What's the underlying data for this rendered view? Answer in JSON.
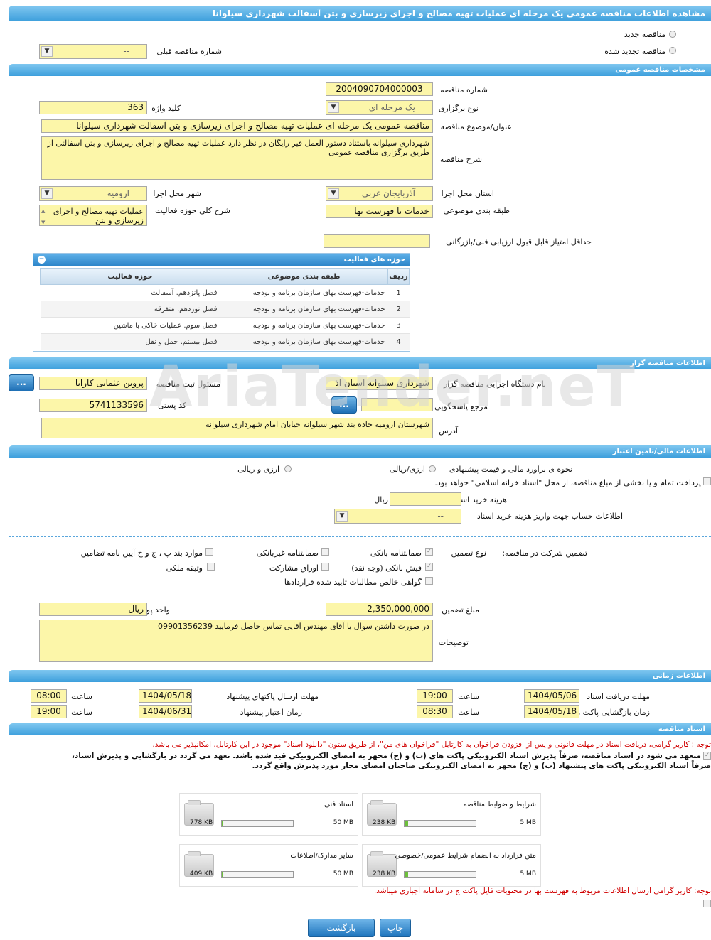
{
  "page_title": "مشاهده اطلاعات مناقصه عمومی یک مرحله ای عملیات تهیه مصالح و اجرای زیرسازی و بتن آسفالت شهرداری سیلوانا",
  "top": {
    "radio_new": "مناقصه جدید",
    "radio_renew": "مناقصه تجدید شده",
    "prev_label": "شماره مناقصه قبلی",
    "prev_value": "--"
  },
  "general": {
    "header": "مشخصات مناقصه عمومی",
    "tender_no_label": "شماره مناقصه",
    "tender_no": "2004090704000003",
    "type_label": "نوع برگزاری",
    "type_value": "یک مرحله ای",
    "keyword_label": "کلید واژه",
    "keyword": "363",
    "title_label": "عنوان/موضوع مناقصه",
    "title_value": "مناقصه عمومی یک مرحله ای عملیات تهیه مصالح و اجرای زیرسازی و بتن آسفالت شهرداری سیلوانا",
    "desc_label": "شرح مناقصه",
    "desc_value": "شهرداری سیلوانه باستناد دستور العمل فیر رایگان در نظر دارد عملیات تهیه مصالح و اجرای زیرسازی و بتن آسفالتی از طریق برگزاری مناقصه عمومی",
    "province_label": "استان محل اجرا",
    "province": "آذربایجان غربی",
    "city_label": "شهر محل اجرا",
    "city": "ارومیه",
    "category_label": "طبقه بندی موضوعی",
    "category": "خدمات با فهرست بها",
    "scope_label": "شرح کلی حوزه فعالیت",
    "scope": "عملیات تهیه مصالح و اجرای زیرسازی و بتن",
    "min_score_label": "حداقل امتیاز قابل قبول ارزیابی فنی/بازرگانی"
  },
  "activities": {
    "header": "حوزه های فعالیت",
    "cols": [
      "ردیف",
      "طبقه بندی موضوعی",
      "حوزه فعالیت"
    ],
    "rows": [
      [
        "1",
        "خدمات-فهرست بهای سازمان برنامه و بودجه",
        "فصل پانزدهم. آسفالت"
      ],
      [
        "2",
        "خدمات-فهرست بهای سازمان برنامه و بودجه",
        "فصل نوزدهم. متفرقه"
      ],
      [
        "3",
        "خدمات-فهرست بهای سازمان برنامه و بودجه",
        "فصل سوم. عملیات خاکی با ماشین"
      ],
      [
        "4",
        "خدمات-فهرست بهای سازمان برنامه و بودجه",
        "فصل بیستم. حمل و نقل"
      ]
    ]
  },
  "organizer": {
    "header": "اطلاعات مناقصه گزار",
    "org_label": "نام دستگاه اجرایی مناقصه گزار",
    "org": "شهرداری سیلوانه استان اذ",
    "resp_label": "مسئول ثبت مناقصه",
    "resp": "پروین  عثمانی کارانا",
    "ref_label": "مرجع پاسخگویی",
    "ref": "",
    "postal_label": "کد پستی",
    "postal": "5741133596",
    "addr_label": "آدرس",
    "addr": "شهرستان ارومیه جاده بند شهر سیلوانه خیابان امام شهرداری سیلوانه",
    "dots": "..."
  },
  "finance": {
    "header": "اطلاعات مالی/تامین اعتبار",
    "estimate_label": "نحوه ی برآورد مالی و قیمت پیشنهادی",
    "opt1": "ارزی/ریالی",
    "opt2": "ارزی و ریالی",
    "islamic_note": "پرداخت تمام و یا بخشی از مبلغ مناقصه، از محل \"اسناد خزانه اسلامی\" خواهد بود.",
    "doc_cost_label": "هزینه خرید اسناد",
    "doc_cost": "",
    "rial": "ریال",
    "account_label": "اطلاعات حساب جهت واریز هزینه خرید اسناد",
    "account": "--"
  },
  "guarantee": {
    "label": "تضمین شرکت در مناقصه:",
    "type_label": "نوع تضمین",
    "items": [
      "ضمانتنامه بانکی",
      "ضمانتنامه غیربانکی",
      "موارد بند پ ، ج و خ آیین نامه تضامین",
      "فیش بانکی (وجه نقد)",
      "اوراق مشارکت",
      "وثیقه ملکی",
      "گواهی خالص مطالبات تایید شده قراردادها"
    ],
    "amount_label": "مبلغ تضمین",
    "amount": "2,350,000,000",
    "unit_label": "واحد پول",
    "unit": "ریال",
    "notes_label": "توضیحات",
    "notes": "در صورت داشتن سوال با آقای مهندس آقایی تماس حاصل فرمایید  09901356239"
  },
  "timing": {
    "header": "اطلاعات زمانی",
    "receive_label": "مهلت دریافت اسناد",
    "receive_date": "1404/05/06",
    "receive_time": "19:00",
    "send_label": "مهلت ارسال پاکتهای پیشنهاد",
    "send_date": "1404/05/18",
    "send_time": "08:00",
    "open_label": "زمان بازگشایی پاکت ها",
    "open_date": "1404/05/18",
    "open_time": "08:30",
    "valid_label": "زمان اعتبار پیشنهاد",
    "valid_date": "1404/06/31",
    "valid_time": "19:00",
    "time_label": "ساعت"
  },
  "docs": {
    "header": "اسناد مناقصه",
    "note1": "توجه : کاربر گرامی، دریافت اسناد در مهلت قانونی و پس از افزودن فراخوان به کارتابل \"فراخوان های من\"، از طریق ستون \"دانلود اسناد\" موجود در این کارتابل، امکانپذیر می باشد.",
    "commit1": "متعهد می شود در اسناد مناقصه، صرفاً پذیرش اسناد الکترونیکی پاکت های (ب) و (ج) مجهز به امضای الکترونیکی قید شده باشد. تعهد می گردد در بازگشایی و پذیرش اسناد،",
    "commit2": "صرفاً اسناد الکترونیکی پاکت های پیشنهاد (ب) و (ج) مجهز به امضای الکترونیکی صاحبان امضای مجاز مورد پذیرش واقع گردد.",
    "files": [
      {
        "name": "شرایط و ضوابط مناقصه",
        "size": "238 KB",
        "max": "5 MB",
        "fill": 0.05
      },
      {
        "name": "اسناد فنی",
        "size": "778 KB",
        "max": "50 MB",
        "fill": 0.02
      },
      {
        "name": "متن قرارداد به انضمام شرایط عمومی/خصوصی",
        "size": "238 KB",
        "max": "5 MB",
        "fill": 0.05
      },
      {
        "name": "سایر مدارک/اطلاعات",
        "size": "409 KB",
        "max": "50 MB",
        "fill": 0.01
      }
    ],
    "note2": "توجه: کاربر گرامی ارسال اطلاعات مربوط به فهرست بها در محتویات فایل پاکت ج در سامانه اجباری میباشد."
  },
  "buttons": {
    "print": "چاپ",
    "back": "بازگشت"
  },
  "watermark": "AriaTender.neT"
}
